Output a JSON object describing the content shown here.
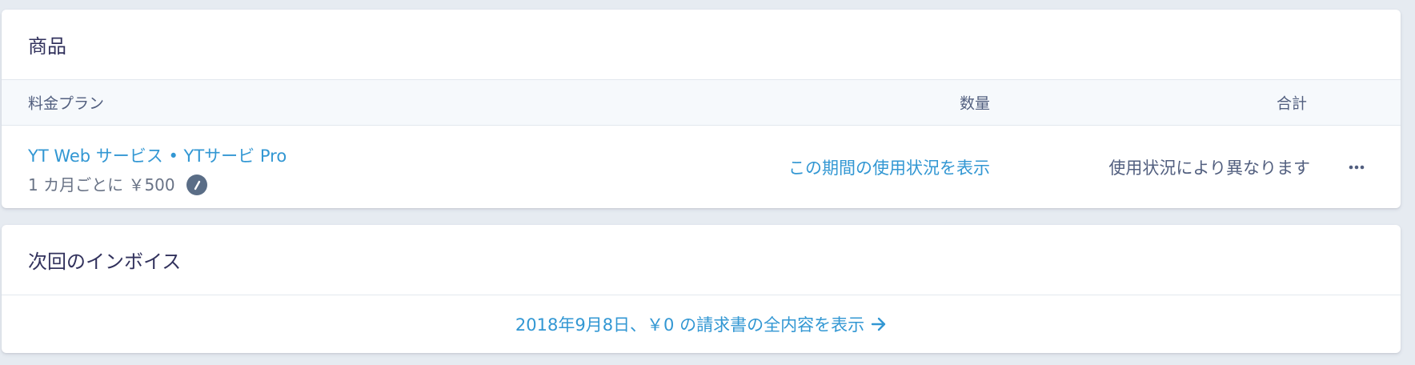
{
  "products": {
    "title": "商品",
    "columns": {
      "plan": "料金プラン",
      "quantity": "数量",
      "total": "合計"
    },
    "row": {
      "plan_name": "YT Web サービス • YTサービ Pro",
      "price": "1 カ月ごとに ￥500",
      "usage_link": "この期間の使用状況を表示",
      "total": "使用状況により異なります",
      "icons": {
        "metered": "speedometer-icon",
        "more": "more-horizontal-icon"
      }
    }
  },
  "next_invoice": {
    "title": "次回のインボイス",
    "link": "2018年9月8日、￥0 の請求書の全内容を表示",
    "icon": "arrow-right-icon"
  },
  "colors": {
    "link": "#3297d3",
    "heading": "#32325d",
    "muted": "#697386",
    "table_head_bg": "#f6f9fc",
    "page_bg": "#e6ebf1"
  }
}
